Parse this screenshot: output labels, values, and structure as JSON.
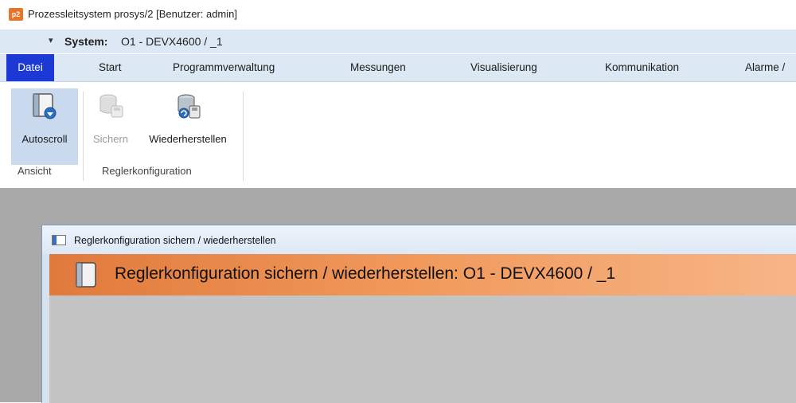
{
  "window": {
    "logo_text": "p2",
    "title": "Prozessleitsystem prosys/2  [Benutzer:  admin]"
  },
  "system": {
    "collapse_glyph": "▾",
    "label": "System:",
    "value": "O1 - DEVX4600 / _1"
  },
  "menu": {
    "items": [
      {
        "label": "Datei"
      },
      {
        "label": "Start"
      },
      {
        "label": "Programmverwaltung"
      },
      {
        "label": "Messungen"
      },
      {
        "label": "Visualisierung"
      },
      {
        "label": "Kommunikation"
      },
      {
        "label": "Alarme /"
      }
    ],
    "active_color": "#1c39d6"
  },
  "ribbon": {
    "groups": [
      {
        "label": "Ansicht",
        "buttons": [
          {
            "label": "Autoscroll",
            "icon": "autoscroll-icon",
            "enabled": true,
            "selected": true
          }
        ]
      },
      {
        "label": "Reglerkonfiguration",
        "buttons": [
          {
            "label": "Sichern",
            "icon": "database-save-icon",
            "enabled": false
          },
          {
            "label": "Wiederherstellen",
            "icon": "database-restore-icon",
            "enabled": true
          }
        ]
      }
    ]
  },
  "child_window": {
    "title": "Reglerkonfiguration sichern / wiederherstellen",
    "header_text": "Reglerkonfiguration sichern / wiederherstellen: O1 - DEVX4600 / _1",
    "header_icon": "document-icon",
    "header_color": "#e07a3c"
  }
}
